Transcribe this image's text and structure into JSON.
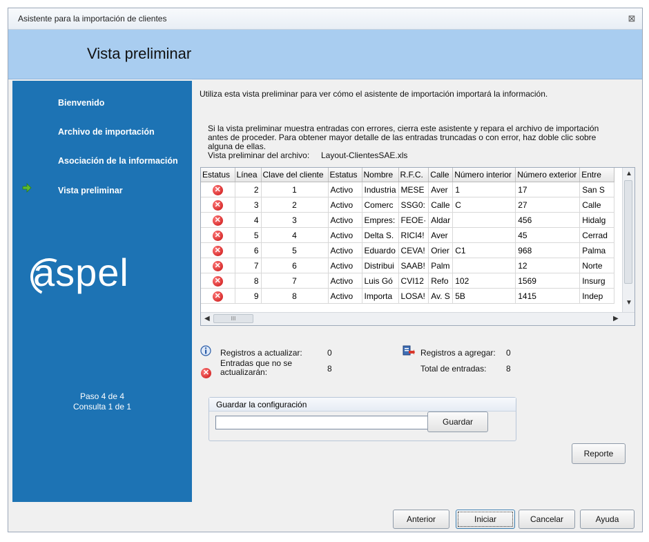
{
  "window": {
    "title": "Asistente para la importación de clientes",
    "close_glyph": "⊠"
  },
  "banner": {
    "heading": "Vista preliminar"
  },
  "sidebar": {
    "items": [
      {
        "label": "Bienvenido"
      },
      {
        "label": "Archivo de importación"
      },
      {
        "label": "Asociación de la información"
      },
      {
        "label": "Vista preliminar",
        "current": true
      }
    ],
    "logo_text": "aspel",
    "step": "Paso 4 de 4",
    "query": "Consulta 1 de 1",
    "colors": {
      "background": "#1d73b4",
      "arrow": "#5dbb2f"
    }
  },
  "main": {
    "intro": "Utiliza esta vista preliminar para ver cómo el asistente de importación importará la información.",
    "instructions_line1": "Si la vista preliminar muestra entradas con errores, cierra este asistente y repara el archivo de importación",
    "instructions_line2": "antes de proceder. Para obtener mayor detalle de las entradas truncadas o con error, haz doble clic sobre",
    "instructions_line3": "alguna de ellas.",
    "file_label": "Vista preliminar del archivo:",
    "file_name": "Layout-ClientesSAE.xls"
  },
  "grid": {
    "columns": [
      "Estatus",
      "Línea",
      "Clave del cliente",
      "Estatus",
      "Nombre",
      "R.F.C.",
      "Calle",
      "Número interior",
      "Número exterior",
      "Entre"
    ],
    "rows": [
      {
        "linea": "2",
        "clave": "1",
        "estatus": "Activo",
        "nombre": "Industria",
        "rfc": "MESE",
        "calle": "Aver",
        "num_int": "1",
        "num_ext": "17",
        "entre": "San S"
      },
      {
        "linea": "3",
        "clave": "2",
        "estatus": "Activo",
        "nombre": "Comerc",
        "rfc": "SSG0:",
        "calle": "Calle",
        "num_int": "C",
        "num_ext": "27",
        "entre": "Calle"
      },
      {
        "linea": "4",
        "clave": "3",
        "estatus": "Activo",
        "nombre": "Empres:",
        "rfc": "FEOE·",
        "calle": "Aldar",
        "num_int": "",
        "num_ext": "456",
        "entre": "Hidalg"
      },
      {
        "linea": "5",
        "clave": "4",
        "estatus": "Activo",
        "nombre": "Delta S.",
        "rfc": "RICI4!",
        "calle": "Aver",
        "num_int": "",
        "num_ext": "45",
        "entre": "Cerrad"
      },
      {
        "linea": "6",
        "clave": "5",
        "estatus": "Activo",
        "nombre": "Eduardo",
        "rfc": "CEVA!",
        "calle": "Orier",
        "num_int": "C1",
        "num_ext": "968",
        "entre": "Palma"
      },
      {
        "linea": "7",
        "clave": "6",
        "estatus": "Activo",
        "nombre": "Distribui",
        "rfc": "SAAB!",
        "calle": "Palm",
        "num_int": "",
        "num_ext": "12",
        "entre": "Norte"
      },
      {
        "linea": "8",
        "clave": "7",
        "estatus": "Activo",
        "nombre": "Luis Gó",
        "rfc": "CVI12",
        "calle": "Refo",
        "num_int": "102",
        "num_ext": "1569",
        "entre": "Insurg"
      },
      {
        "linea": "9",
        "clave": "8",
        "estatus": "Activo",
        "nombre": "Importa",
        "rfc": "LOSA!",
        "calle": "Av. S",
        "num_int": "5B",
        "num_ext": "1415",
        "entre": "Indep"
      }
    ],
    "hthumb_glyph": "III"
  },
  "stats": {
    "update_label": "Registros a actualizar:",
    "update_value": "0",
    "fail_label_line1": "Entradas que no se",
    "fail_label_line2": "actualizarán:",
    "fail_value": "8",
    "add_label": "Registros a agregar:",
    "add_value": "0",
    "total_label": "Total de entradas:",
    "total_value": "8"
  },
  "config": {
    "legend": "Guardar la configuración",
    "input_value": "",
    "save_button": "Guardar"
  },
  "buttons": {
    "report": "Reporte",
    "prev": "Anterior",
    "start": "Iniciar",
    "cancel": "Cancelar",
    "help": "Ayuda"
  }
}
